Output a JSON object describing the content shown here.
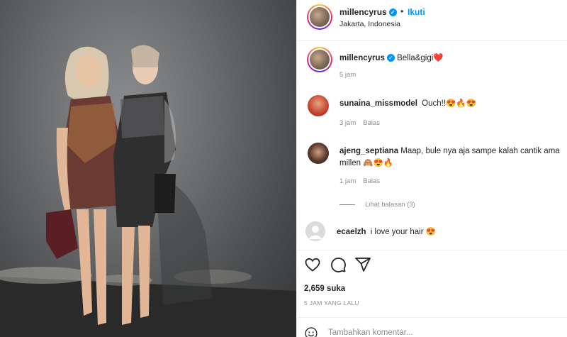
{
  "post": {
    "author": "millencyrus",
    "follow_label": "Ikuti",
    "separator": "•",
    "location": "Jakarta, Indonesia",
    "caption": "Bella&gigi",
    "caption_emoji": "❤️",
    "caption_time": "5 jam"
  },
  "comments": [
    {
      "user": "sunaina_missmodel",
      "text": "Ouch!!😍🔥😍",
      "time": "3 jam",
      "reply": "Balas"
    },
    {
      "user": "ajeng_septiana",
      "text_line1": "Maap, bule nya aja sampe kalah cantik ama",
      "text_line2": "millen 🙈😍🔥",
      "time": "1 jam",
      "reply": "Balas",
      "view_replies": "Lihat balasan (3)"
    },
    {
      "user": "ecaelzh",
      "text": "i love your hair 😍"
    }
  ],
  "stats": {
    "likes": "2,659 suka",
    "posted": "5 JAM YANG LALU"
  },
  "composer": {
    "placeholder": "Tambahkan komentar..."
  },
  "colors": {
    "accent": "#0095f6",
    "muted": "#8e8e8e",
    "text": "#262626"
  },
  "icons": [
    "verified-icon",
    "heart-icon",
    "comment-icon",
    "share-icon",
    "emoji-icon"
  ]
}
